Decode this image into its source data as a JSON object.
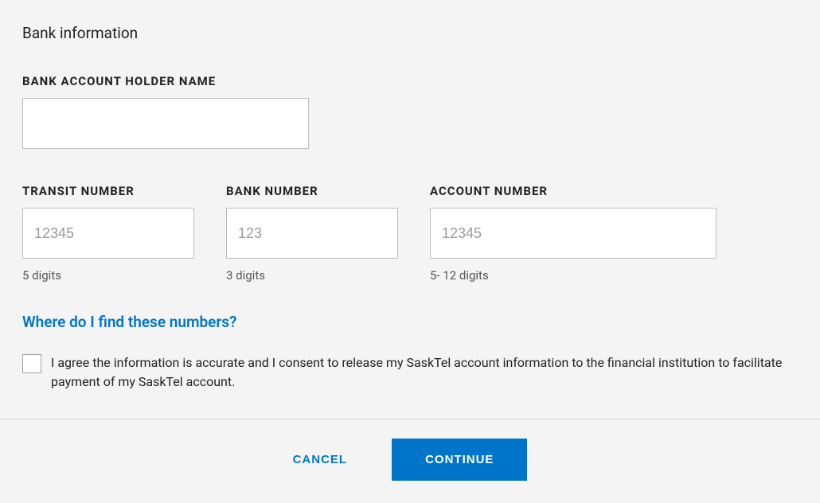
{
  "section_title": "Bank information",
  "holder_name": {
    "label": "BANK ACCOUNT HOLDER NAME",
    "value": ""
  },
  "transit": {
    "label": "TRANSIT NUMBER",
    "placeholder": "12345",
    "value": "",
    "helper": "5 digits"
  },
  "bank": {
    "label": "BANK NUMBER",
    "placeholder": "123",
    "value": "",
    "helper": "3 digits"
  },
  "account": {
    "label": "ACCOUNT NUMBER",
    "placeholder": "12345",
    "value": "",
    "helper": "5- 12 digits"
  },
  "help_link": "Where do I find these numbers?",
  "consent_text": "I agree the information is accurate and I consent to release my SaskTel account information to the financial institution to facilitate payment of my SaskTel account.",
  "footer": {
    "cancel": "CANCEL",
    "continue": "CONTINUE"
  }
}
